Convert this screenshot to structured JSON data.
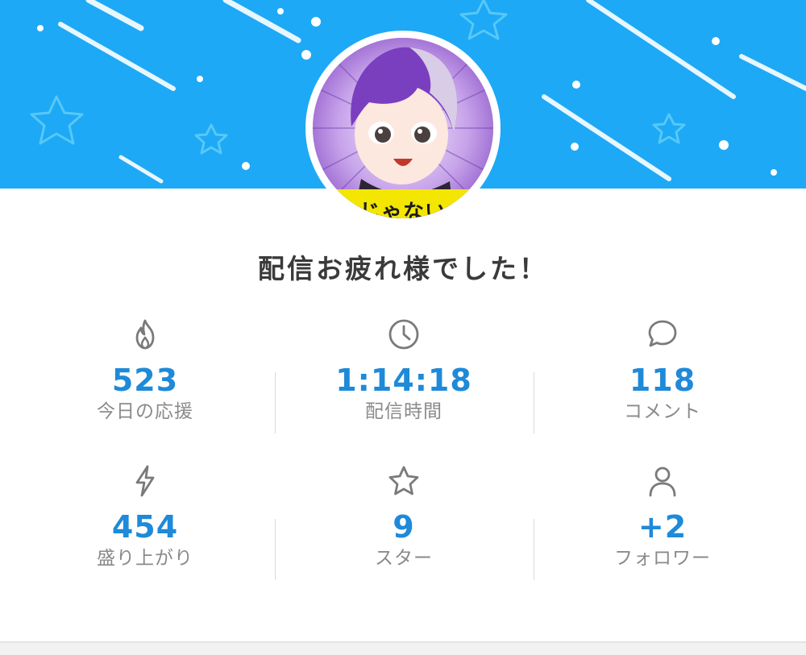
{
  "header": {
    "avatar_caption": "じゃない"
  },
  "title": "配信お疲れ様でした！",
  "stats": [
    {
      "icon": "fire-icon",
      "value": "523",
      "label": "今日の応援"
    },
    {
      "icon": "clock-icon",
      "value": "1:14:18",
      "label": "配信時間"
    },
    {
      "icon": "comment-icon",
      "value": "118",
      "label": "コメント"
    },
    {
      "icon": "lightning-icon",
      "value": "454",
      "label": "盛り上がり"
    },
    {
      "icon": "star-icon",
      "value": "9",
      "label": "スター"
    },
    {
      "icon": "user-icon",
      "value": "+2",
      "label": "フォロワー"
    }
  ],
  "colors": {
    "banner": "#1da9f5",
    "value": "#1e8ad9",
    "label": "#8a8a8a",
    "icon": "#7a7a7a"
  }
}
